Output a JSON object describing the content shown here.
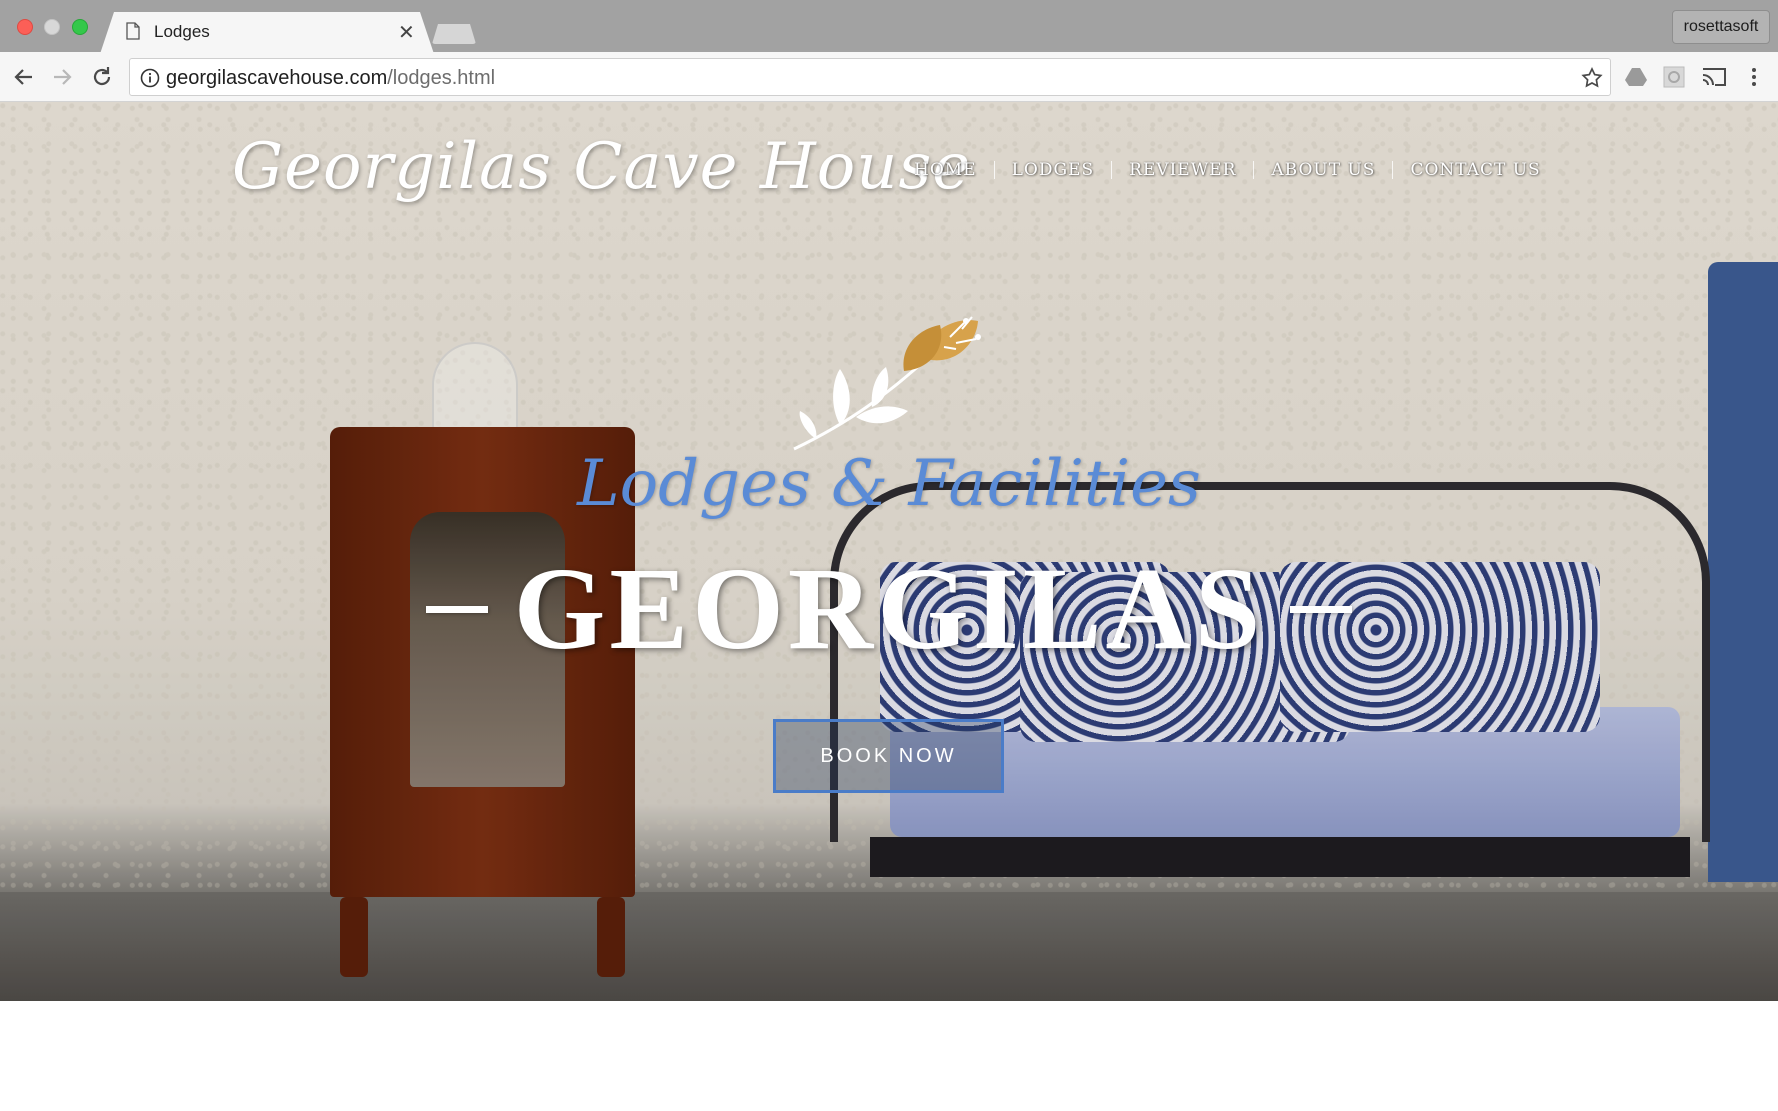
{
  "browser": {
    "tab_title": "Lodges",
    "url_host": "georgilascavehouse.com",
    "url_path": "/lodges.html",
    "profile_name": "rosettasoft"
  },
  "site": {
    "logo": "Georgilas Cave House",
    "nav": [
      "HOME",
      "LODGES",
      "REVIEWER",
      "ABOUT US",
      "CONTACT US"
    ],
    "subtitle": "Lodges & Facilities",
    "headline": "GEORGILAS",
    "cta": "BOOK NOW"
  },
  "colors": {
    "accent_blue": "#5a8bd6",
    "button_border": "#4a7cc8",
    "ornament_gold": "#d7a24b"
  },
  "icons": [
    "page-icon",
    "close-icon",
    "back-icon",
    "forward-icon",
    "reload-icon",
    "info-icon",
    "star-icon",
    "drive-icon",
    "extension-icon",
    "cast-icon",
    "menu-icon"
  ]
}
